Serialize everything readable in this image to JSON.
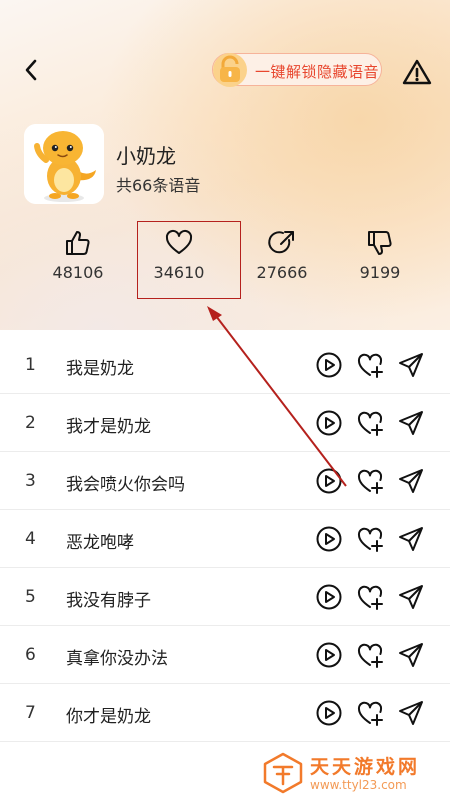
{
  "header": {
    "unlock_label": "一键解锁隐藏语音"
  },
  "profile": {
    "title": "小奶龙",
    "subtitle": "共66条语音"
  },
  "stats": [
    {
      "icon": "thumbs-up-icon",
      "value": "48106"
    },
    {
      "icon": "heart-icon",
      "value": "34610"
    },
    {
      "icon": "share-icon",
      "value": "27666"
    },
    {
      "icon": "thumbs-down-icon",
      "value": "9199"
    }
  ],
  "list": [
    {
      "index": "1",
      "name": "我是奶龙"
    },
    {
      "index": "2",
      "name": "我才是奶龙"
    },
    {
      "index": "3",
      "name": "我会喷火你会吗"
    },
    {
      "index": "4",
      "name": "恶龙咆哮"
    },
    {
      "index": "5",
      "name": "我没有脖子"
    },
    {
      "index": "6",
      "name": "真拿你没办法"
    },
    {
      "index": "7",
      "name": "你才是奶龙"
    }
  ],
  "watermark": {
    "title": "天天游戏网",
    "url": "www.ttyl23.com"
  },
  "colors": {
    "accent": "#e8472f",
    "annotation": "#b5211d",
    "watermark": "#f27a2b"
  }
}
